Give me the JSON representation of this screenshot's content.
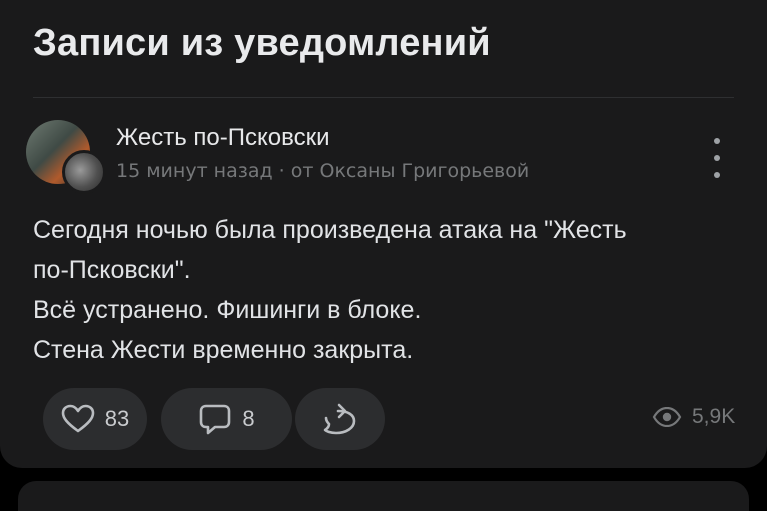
{
  "page": {
    "title": "Записи из уведомлений"
  },
  "post": {
    "author": "Жесть по-Псковски",
    "time": "15 минут назад",
    "separator": "·",
    "from": "от Оксаны Григорьевой",
    "text_lines": [
      "Сегодня ночью была произведена атака на \"Жесть",
      "по-Псковски\".",
      "Всё устранено. Фишинги в блоке.",
      "Стена Жести временно закрыта."
    ],
    "actions": {
      "likes": "83",
      "comments": "8",
      "views": "5,9K"
    }
  },
  "icons": {
    "like": "heart-icon",
    "comment": "comment-icon",
    "share": "share-icon",
    "views": "eye-icon",
    "more": "more-vertical-icon"
  },
  "colors": {
    "background": "#000000",
    "card": "#1a1a1b",
    "pill": "#2c2d2f",
    "text": "#e1e3e6",
    "secondary": "#76787a"
  }
}
